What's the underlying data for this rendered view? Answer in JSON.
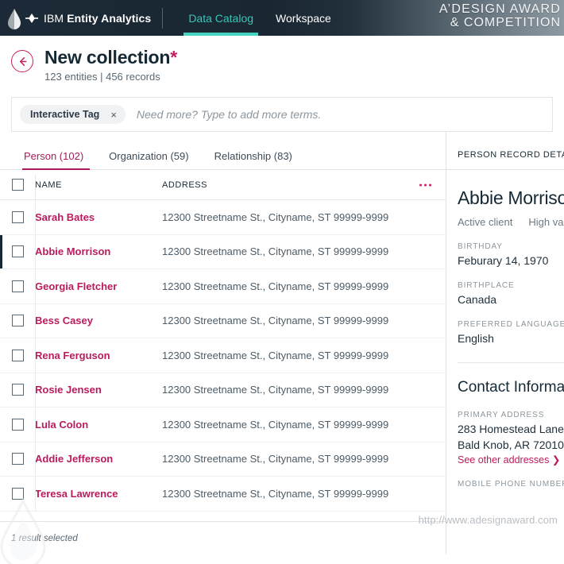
{
  "topnav": {
    "brand_ibm": "IBM",
    "brand_product": "Entity Analytics",
    "tabs": [
      {
        "label": "Data Catalog",
        "active": true
      },
      {
        "label": "Workspace",
        "active": false
      }
    ],
    "award_line1": "A’DESIGN AWARD",
    "award_line2": "& COMPETITION",
    "accent_active": "#45d3c2",
    "background": "#1a2733"
  },
  "pagehead": {
    "back_icon": "arrow-left-icon",
    "title": "New collection",
    "title_modified_marker": "*",
    "subtitle": "123 entities | 456 records"
  },
  "search": {
    "chip_label": "Interactive Tag",
    "chip_remove": "×",
    "placeholder": "Need more? Type to add more terms.",
    "value": ""
  },
  "tabs": [
    {
      "label": "Person (102)",
      "active": true
    },
    {
      "label": "Organization (59)",
      "active": false
    },
    {
      "label": "Relationship (83)",
      "active": false
    }
  ],
  "table": {
    "columns": [
      "NAME",
      "ADDRESS"
    ],
    "overflow_icon": "kebab-menu-icon",
    "rows": [
      {
        "name": "Sarah Bates",
        "address": "12300 Streetname St., Cityname, ST 99999-9999",
        "selected": false
      },
      {
        "name": "Abbie Morrison",
        "address": "12300 Streetname St., Cityname, ST 99999-9999",
        "selected": true
      },
      {
        "name": "Georgia Fletcher",
        "address": "12300 Streetname St., Cityname, ST 99999-9999",
        "selected": false
      },
      {
        "name": "Bess Casey",
        "address": "12300 Streetname St., Cityname, ST 99999-9999",
        "selected": false
      },
      {
        "name": "Rena Ferguson",
        "address": "12300 Streetname St., Cityname, ST 99999-9999",
        "selected": false
      },
      {
        "name": "Rosie Jensen",
        "address": "12300 Streetname St., Cityname, ST 99999-9999",
        "selected": false
      },
      {
        "name": "Lula Colon",
        "address": "12300 Streetname St., Cityname, ST 99999-9999",
        "selected": false
      },
      {
        "name": "Addie Jefferson",
        "address": "12300 Streetname St., Cityname, ST 99999-9999",
        "selected": false
      },
      {
        "name": "Teresa Lawrence",
        "address": "12300 Streetname St., Cityname, ST 99999-9999",
        "selected": false
      }
    ]
  },
  "detail": {
    "panel_title": "PERSON RECORD DETAILS",
    "record_name": "Abbie Morrison",
    "meta_left": "Active client",
    "meta_right": "High value",
    "fields": [
      {
        "label": "BIRTHDAY",
        "value": "Feburary 14, 1970"
      },
      {
        "label": "BIRTHPLACE",
        "value": "Canada"
      },
      {
        "label": "PREFERRED LANGUAGE",
        "value": "English"
      }
    ],
    "section_title": "Contact Information",
    "address_label": "PRIMARY ADDRESS",
    "address_line1": "283 Homestead Lane",
    "address_line2": "Bald Knob, AR 72010",
    "address_link": "See other addresses ❯",
    "phone_label": "MOBILE PHONE NUMBER"
  },
  "statusbar": {
    "text": "1 result selected"
  },
  "watermark": {
    "url": "http://www.adesignaward.com",
    "logo_icon": "a-design-award-drop-icon"
  }
}
